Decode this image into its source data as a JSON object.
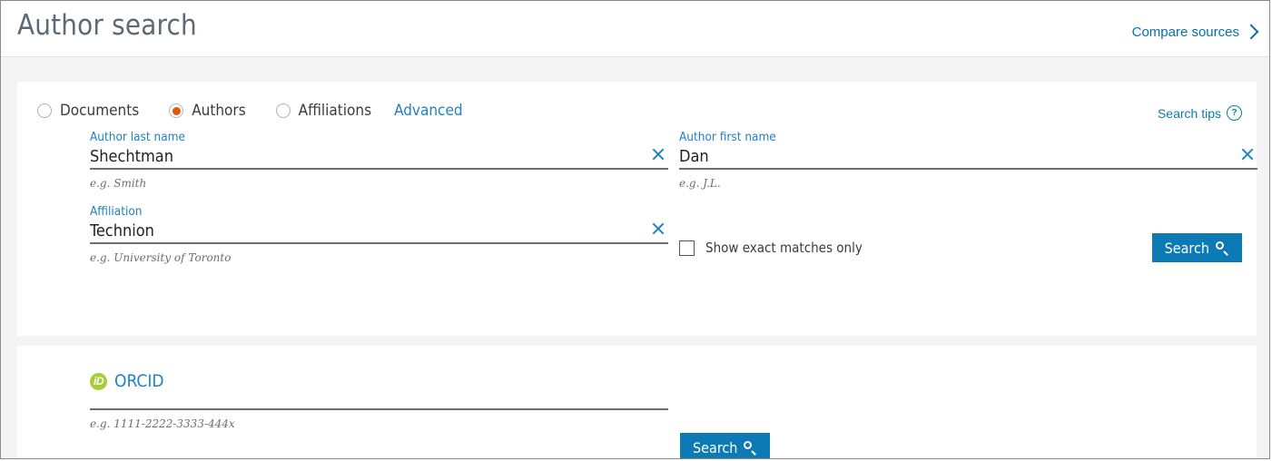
{
  "header": {
    "title": "Author search",
    "compare_sources_label": "Compare sources",
    "chevron_icon": "chevron-right-icon"
  },
  "search_panel": {
    "search_types": [
      {
        "label": "Documents",
        "selected": false
      },
      {
        "label": "Authors",
        "selected": true
      },
      {
        "label": "Affiliations",
        "selected": false
      }
    ],
    "advanced_label": "Advanced",
    "search_tips_label": "Search tips",
    "search_tips_icon": "question-circle-icon",
    "fields": {
      "last_name": {
        "label": "Author last name",
        "value": "Shechtman",
        "hint": "e.g. Smith",
        "clear_icon": "close-x-icon"
      },
      "first_name": {
        "label": "Author first name",
        "value": "Dan",
        "hint": "e.g. J.L.",
        "clear_icon": "close-x-icon"
      },
      "affiliation": {
        "label": "Affiliation",
        "value": "Technion",
        "hint": "e.g. University of Toronto",
        "clear_icon": "close-x-icon"
      }
    },
    "exact_matches": {
      "label": "Show exact matches only",
      "checked": false
    },
    "search_button": {
      "label": "Search",
      "icon": "magnifier-icon"
    }
  },
  "orcid_panel": {
    "logo_text": "iD",
    "label": "ORCID",
    "value": "",
    "placeholder": "",
    "hint": "e.g. 1111-2222-3333-444x",
    "search_button": {
      "label": "Search",
      "icon": "magnifier-icon"
    }
  },
  "colors": {
    "brand_blue": "#0c7ab5",
    "link_blue": "#1e82c4",
    "radio_selected": "#e0590a",
    "orcid_green": "#a6ce39",
    "page_bg": "#f4f4f4",
    "title_gray": "#5b6a76"
  }
}
